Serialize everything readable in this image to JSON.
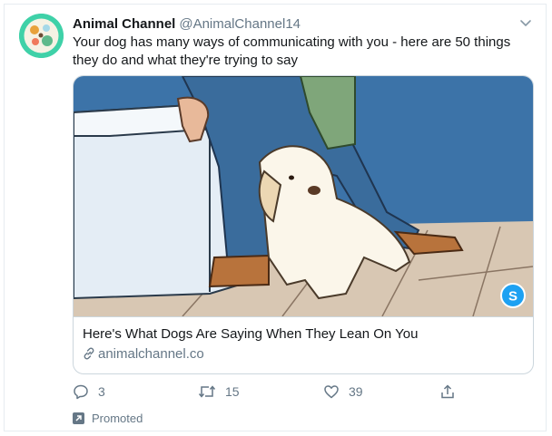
{
  "tweet": {
    "author_name": "Animal Channel",
    "author_handle": "@AnimalChannel14",
    "text": "Your dog has many ways of communicating with you - here are 50 things they do and what they're trying to say",
    "card": {
      "title": "Here's What Dogs Are Saying When They Lean On You",
      "domain": "animalchannel.co",
      "badge_letter": "S"
    },
    "actions": {
      "replies": "3",
      "retweets": "15",
      "likes": "39"
    },
    "promoted_label": "Promoted"
  },
  "colors": {
    "avatar": "#3fd1a8",
    "secondary_text": "#657786",
    "card_border": "#ccd6dd",
    "badge": "#1da1f2"
  },
  "icons": [
    "caret-down-icon",
    "link-icon",
    "reply-icon",
    "retweet-icon",
    "like-icon",
    "share-icon",
    "promoted-icon"
  ]
}
